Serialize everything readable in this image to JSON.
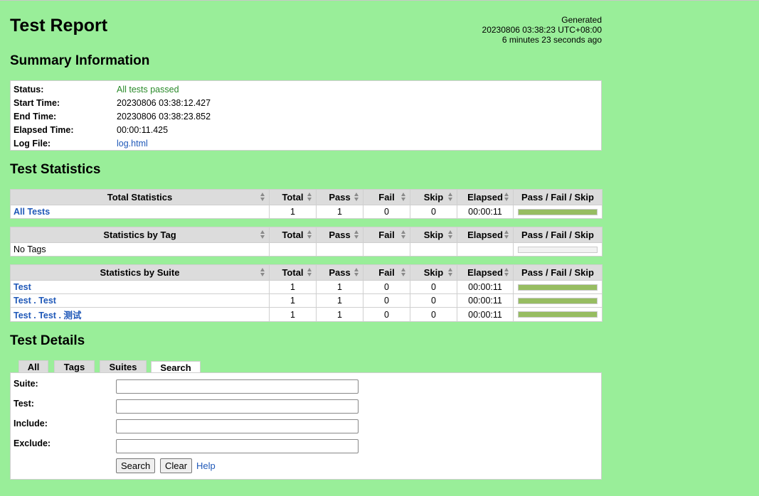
{
  "header": {
    "title": "Test Report",
    "generated_label": "Generated",
    "generated_time": "20230806 03:38:23 UTC+08:00",
    "generated_ago": "6 minutes 23 seconds ago"
  },
  "summary": {
    "heading": "Summary Information",
    "rows": [
      {
        "label": "Status:",
        "value": "All tests passed"
      },
      {
        "label": "Start Time:",
        "value": "20230806 03:38:12.427"
      },
      {
        "label": "End Time:",
        "value": "20230806 03:38:23.852"
      },
      {
        "label": "Elapsed Time:",
        "value": "00:00:11.425"
      },
      {
        "label": "Log File:",
        "value": "log.html"
      }
    ]
  },
  "statistics": {
    "heading": "Test Statistics",
    "columns": [
      "Total",
      "Pass",
      "Fail",
      "Skip",
      "Elapsed",
      "Pass / Fail / Skip"
    ],
    "total": {
      "header": "Total Statistics",
      "rows": [
        {
          "name": "All Tests",
          "total": "1",
          "pass": "1",
          "fail": "0",
          "skip": "0",
          "elapsed": "00:00:11",
          "pass_fraction": 1
        }
      ]
    },
    "tag": {
      "header": "Statistics by Tag",
      "rows": [
        {
          "name": "No Tags",
          "total": "",
          "pass": "",
          "fail": "",
          "skip": "",
          "elapsed": "",
          "pass_fraction": 0
        }
      ]
    },
    "suite": {
      "header": "Statistics by Suite",
      "rows": [
        {
          "name": "Test",
          "total": "1",
          "pass": "1",
          "fail": "0",
          "skip": "0",
          "elapsed": "00:00:11",
          "pass_fraction": 1
        },
        {
          "name": "Test . Test",
          "total": "1",
          "pass": "1",
          "fail": "0",
          "skip": "0",
          "elapsed": "00:00:11",
          "pass_fraction": 1
        },
        {
          "name": "Test . Test . 测试",
          "total": "1",
          "pass": "1",
          "fail": "0",
          "skip": "0",
          "elapsed": "00:00:11",
          "pass_fraction": 1
        }
      ]
    }
  },
  "details": {
    "heading": "Test Details",
    "tabs": [
      "All",
      "Tags",
      "Suites",
      "Search"
    ],
    "selected_tab": "Search",
    "search": {
      "fields": [
        {
          "label": "Suite:",
          "value": ""
        },
        {
          "label": "Test:",
          "value": ""
        },
        {
          "label": "Include:",
          "value": ""
        },
        {
          "label": "Exclude:",
          "value": ""
        }
      ],
      "search_button": "Search",
      "clear_button": "Clear",
      "help_link": "Help"
    }
  },
  "colors": {
    "background": "#99ee99",
    "pass_bar": "#97bd61",
    "link": "#1f58b8",
    "pass_text": "#2a8a2a"
  }
}
